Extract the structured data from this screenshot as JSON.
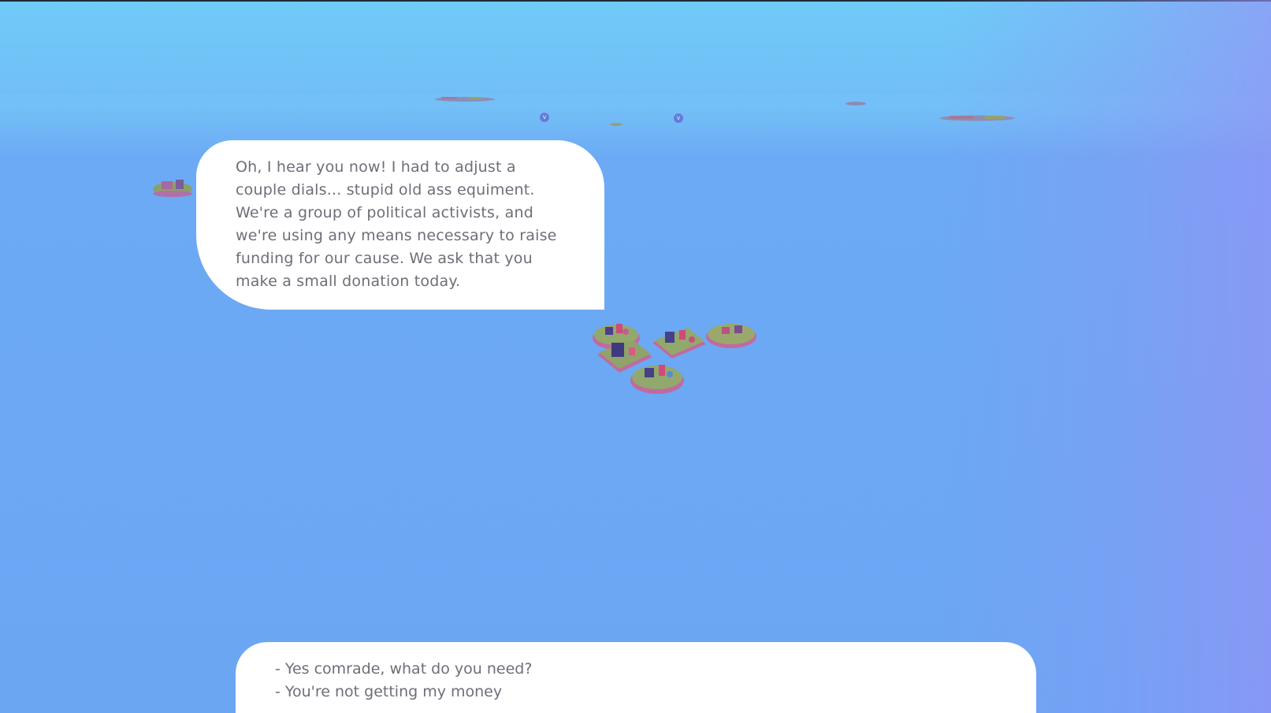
{
  "dialogue": {
    "npc_text": "Oh, I hear you now! I had to adjust a\ncouple dials... stupid old ass equiment.\nWe're a group of political activists, and\nwe're using any means necessary to raise\nfunding for our cause. We ask that you\nmake a small donation today."
  },
  "choices": [
    {
      "label": "- Yes comrade, what do you need?"
    },
    {
      "label": "- You're not getting my money"
    }
  ],
  "markers": [
    {
      "glyph": "v"
    },
    {
      "glyph": "v"
    }
  ],
  "colors": {
    "sky_top": "#6fcbf8",
    "sea": "#6ba6f3",
    "panel": "#ffffff",
    "text": "#6d6f78"
  }
}
